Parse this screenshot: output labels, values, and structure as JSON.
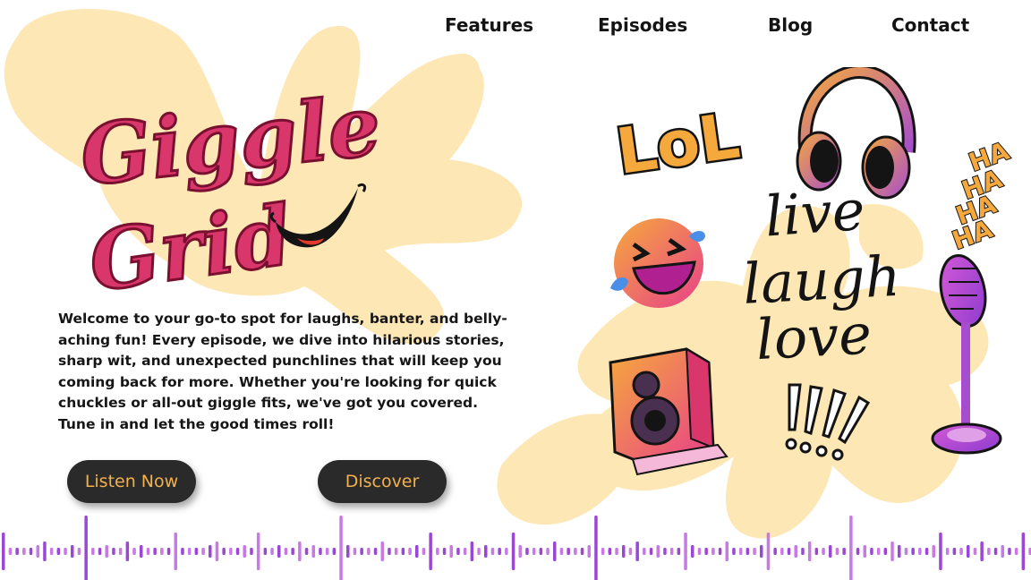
{
  "nav": {
    "features": "Features",
    "episodes": "Episodes",
    "blog": "Blog",
    "contact": "Contact"
  },
  "logo": {
    "line1": "Giggle",
    "line2": "Grid"
  },
  "intro_text": "Welcome to your go-to spot for laughs, banter, and belly-aching fun! Every episode, we dive into hilarious stories, sharp wit, and unexpected punchlines that will keep you coming back for more. Whether you're looking for quick chuckles or all-out giggle fits, we've got you covered. Tune in and let the good times roll!",
  "buttons": {
    "listen": "Listen Now",
    "discover": "Discover"
  },
  "stickers": {
    "lol": "LoL",
    "haha": [
      "HA",
      "HA",
      "HA",
      "HA"
    ],
    "live": "live",
    "laugh": "laugh",
    "love": "love",
    "exclaim": "!!!!"
  },
  "colors": {
    "blob": "#fde7b4",
    "logo_pink": "#d9366b",
    "logo_outline": "#7a1030",
    "button_bg": "#2a2a2a",
    "button_text": "#f2b14c",
    "accent_orange": "#f5a93c",
    "accent_purple": "#a64ccf",
    "wave_purple": "#9b47d6"
  },
  "icons": [
    "headphones-icon",
    "laughing-emoji-icon",
    "speaker-icon",
    "microphone-icon",
    "sound-wave"
  ]
}
